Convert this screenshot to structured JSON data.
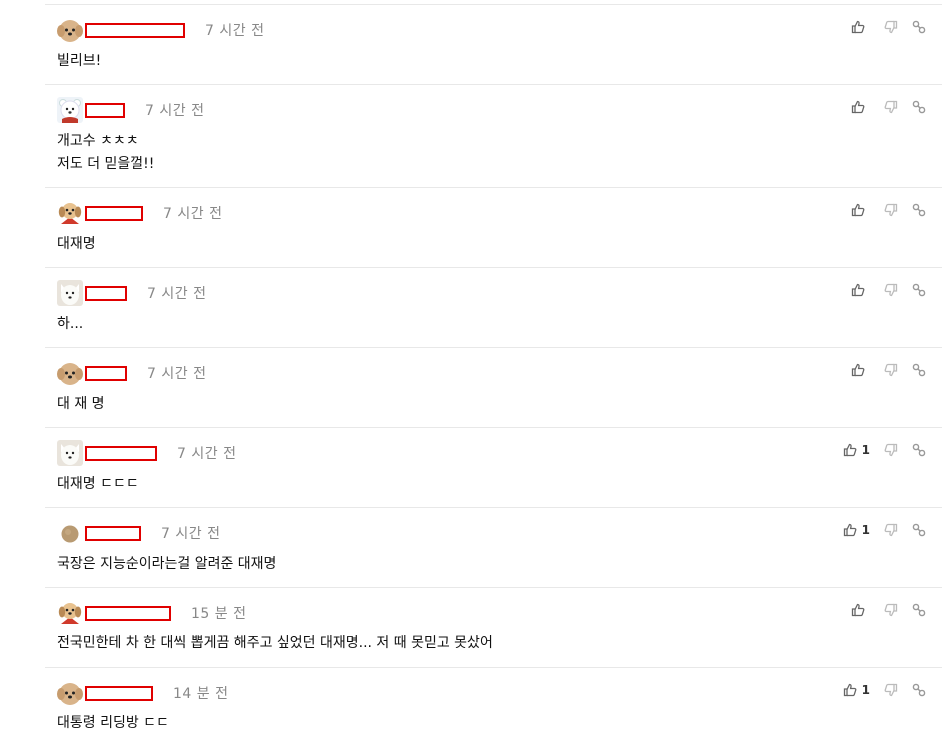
{
  "comments": [
    {
      "avatar": "puppy-fluffy",
      "time": "7 시간 전",
      "text": "빌리브!",
      "likes": ""
    },
    {
      "avatar": "bear-white",
      "time": "7 시간 전",
      "text": "개고수 ㅊㅊㅊ\n저도 더 믿을껄!!",
      "likes": ""
    },
    {
      "avatar": "puppy-cape",
      "time": "7 시간 전",
      "text": "대재명",
      "likes": ""
    },
    {
      "avatar": "white-dog",
      "time": "7 시간 전",
      "text": "하...",
      "likes": ""
    },
    {
      "avatar": "puppy-fluffy",
      "time": "7 시간 전",
      "text": "대 재 명",
      "likes": ""
    },
    {
      "avatar": "white-dog",
      "time": "7 시간 전",
      "text": "대재명 ㄷㄷㄷ",
      "likes": "1"
    },
    {
      "avatar": "brown-circle",
      "time": "7 시간 전",
      "text": "국장은 지능순이라는걸 알려준 대재명",
      "likes": "1"
    },
    {
      "avatar": "puppy-cape",
      "time": "15 분 전",
      "text": "전국민한테 차 한 대씩 뽑게끔 해주고 싶었던 대재명... 저 때 못믿고 못샀어",
      "likes": ""
    },
    {
      "avatar": "puppy-fluffy",
      "time": "14 분 전",
      "text": "대통령 리딩방 ㄷㄷ",
      "likes": "1"
    }
  ],
  "icons": {
    "like": "thumbs-up-icon",
    "dislike": "thumbs-down-icon",
    "link": "link-icon"
  },
  "colors": {
    "redaction": "#e00000",
    "time": "#888888",
    "icon": "#777777"
  }
}
